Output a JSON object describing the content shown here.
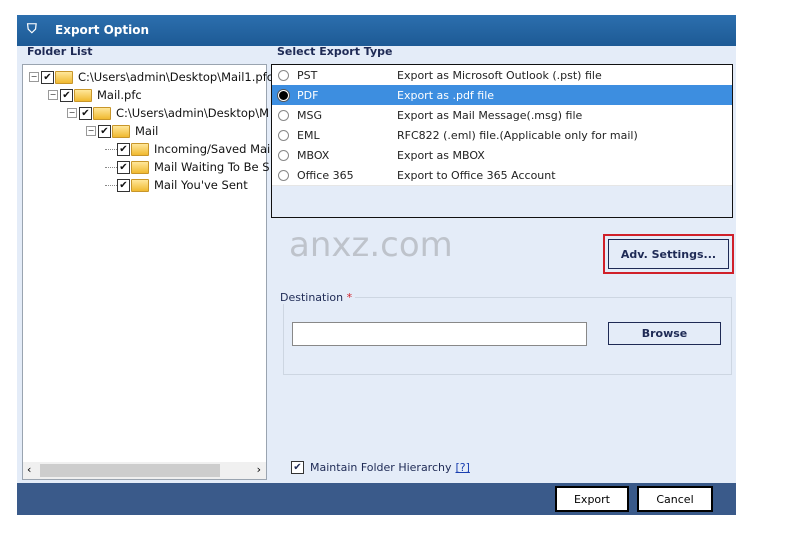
{
  "window": {
    "title": "Export Option",
    "icon": "app-shield-icon"
  },
  "folder_list": {
    "label": "Folder List",
    "nodes": [
      {
        "label": "C:\\Users\\admin\\Desktop\\Mail1.pfc",
        "level": 0,
        "expanded": true,
        "checked": true
      },
      {
        "label": "Mail.pfc",
        "level": 1,
        "expanded": true,
        "checked": true
      },
      {
        "label": "C:\\Users\\admin\\Desktop\\M",
        "level": 2,
        "expanded": true,
        "checked": true
      },
      {
        "label": "Mail",
        "level": 3,
        "expanded": true,
        "checked": true
      },
      {
        "label": "Incoming/Saved Mai",
        "level": 4,
        "checked": true
      },
      {
        "label": "Mail Waiting To Be S",
        "level": 4,
        "checked": true
      },
      {
        "label": "Mail You've Sent",
        "level": 4,
        "checked": true
      }
    ]
  },
  "export_type": {
    "label": "Select Export Type",
    "options": [
      {
        "name": "PST",
        "desc": "Export as Microsoft Outlook (.pst) file",
        "selected": false
      },
      {
        "name": "PDF",
        "desc": "Export as .pdf file",
        "selected": true
      },
      {
        "name": "MSG",
        "desc": "Export as Mail Message(.msg) file",
        "selected": false
      },
      {
        "name": "EML",
        "desc": "RFC822 (.eml) file.(Applicable only for mail)",
        "selected": false
      },
      {
        "name": "MBOX",
        "desc": "Export as MBOX",
        "selected": false
      },
      {
        "name": "Office 365",
        "desc": "Export to Office 365 Account",
        "selected": false
      }
    ]
  },
  "adv_settings": "Adv. Settings...",
  "destination": {
    "label": "Destination",
    "required": "*",
    "value": "",
    "browse": "Browse"
  },
  "maintain_hierarchy": {
    "label": "Maintain Folder Hierarchy",
    "help": "[?]",
    "checked": true
  },
  "footer": {
    "export": "Export",
    "cancel": "Cancel"
  },
  "watermark": "anxz.com",
  "colors": {
    "title_bar": "#1d5a95",
    "selection": "#3d8ee0",
    "footer": "#3a5a8a",
    "highlight_border": "#d0202a"
  }
}
